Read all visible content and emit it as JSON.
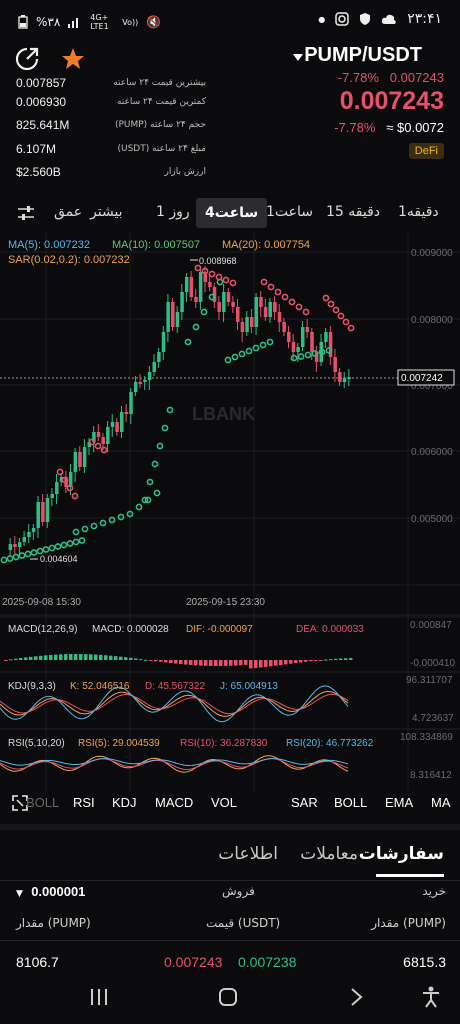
{
  "status_bar": {
    "time": "۲۳:۴۱",
    "battery": "%۳۸",
    "network": "4G+ LTE1",
    "volte": "Vo)) "
  },
  "header": {
    "pair": "PUMP/USDT",
    "change_pct": "-7.78%",
    "mini_price": "0.007243",
    "last_price": "0.007243",
    "usd_change": "-7.78%",
    "usd_price": "≈ $0.0072",
    "tag": "DeFi"
  },
  "stats": [
    {
      "value": "0.007857",
      "label": "بیشترین قیمت ۲۴ ساعته"
    },
    {
      "value": "0.006930",
      "label": "کمترین قیمت ۲۴ ساعته"
    },
    {
      "value": "825.641M",
      "label": "(PUMP) حجم ۲۴ ساعته"
    },
    {
      "value": "6.107M",
      "label": "(USDT) مبلغ ۲۴ ساعته"
    },
    {
      "value": "$2.560B",
      "label": "ارزش بازار"
    }
  ],
  "timeframe_tabs": {
    "depth": "عمق",
    "more": "بیشتر",
    "day1": "1 روز",
    "h4": "4ساعت",
    "h1": "1ساعت",
    "m15": "15 دقیقه",
    "m1": "1دقیقه"
  },
  "chart_indicators": {
    "ma5": "MA(5): 0.007232",
    "ma10": "MA(10): 0.007507",
    "ma20": "MA(20): 0.007754",
    "sar": "SAR(0.02,0.2): 0.007232",
    "macd_title": "MACD(12,26,9)",
    "macd_val": "MACD: 0.000028",
    "dif": "DIF: -0.000097",
    "dea": "DEA: 0.000033",
    "kdj_title": "KDJ(9,3,3)",
    "k": "K: 52.046516",
    "d": "D: 45.567322",
    "j": "J: 65.004913",
    "rsi_title": "RSI(5,10,20)",
    "rsi5": "RSI(5): 29.004539",
    "rsi10": "RSI(10): 36.287830",
    "rsi20": "RSI(20): 46.773262"
  },
  "chart_data": {
    "type": "candlestick",
    "yaxis_labels": [
      "0.009000",
      "0.008000",
      "0.007000",
      "0.006000",
      "0.005000"
    ],
    "current_price_label": "0.007242",
    "high_marker": "0.008968",
    "low_marker": "0.004604",
    "x_labels": [
      "2025-09-08 15:30",
      "2025-09-15 23:30"
    ],
    "macd_axis": [
      "0.000847",
      "-0.000410"
    ],
    "kdj_axis": [
      "96.311707",
      "4.723637"
    ],
    "rsi_axis": [
      "108.334869",
      "8.316412"
    ],
    "watermark": "LBANK"
  },
  "indicator_tabs": {
    "boll_l": "BOLL",
    "rsi": "RSI",
    "kdj": "KDJ",
    "macd": "MACD",
    "vol": "VOL",
    "sar": "SAR",
    "boll_r": "BOLL",
    "ema": "EMA",
    "ma": "MA"
  },
  "order_tabs": {
    "orders": "سفارشات",
    "trades": "معاملات",
    "info": "اطلاعات"
  },
  "orderbook": {
    "buy": "خرید",
    "sell": "فروش",
    "precision": "0.000001",
    "qty_left": "مقدار (PUMP)",
    "price_header": "قیمت (USDT)",
    "qty_right": "مقدار (PUMP)",
    "row_left_qty": "8106.7",
    "row_ask": "0.007243",
    "row_bid": "0.007238",
    "row_right_qty": "6815.3"
  },
  "colors": {
    "up": "#2ebd85",
    "down": "#e6506d",
    "accent": "#f0b90b"
  }
}
